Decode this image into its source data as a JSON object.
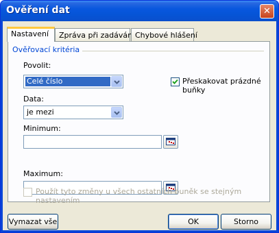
{
  "window": {
    "title": "Ověření dat"
  },
  "tabs": [
    {
      "label": "Nastavení"
    },
    {
      "label": "Zpráva při zadávání"
    },
    {
      "label": "Chybové hlášení"
    }
  ],
  "criteria": {
    "group_label": "Ověřovací kritéria",
    "allow_label": "Povolit:",
    "allow_value": "Celé číslo",
    "ignore_blank_label": "Přeskakovat prázdné buňky",
    "ignore_blank_checked": true,
    "data_label": "Data:",
    "data_value": "je mezi",
    "minimum_label": "Minimum:",
    "minimum_value": "",
    "maximum_label": "Maximum:",
    "maximum_value": ""
  },
  "apply_all": {
    "label": "Použít tyto změny u všech ostatních buněk se stejným nastavením",
    "checked": false,
    "enabled": false
  },
  "buttons": {
    "clear_all": "Vymazat vše",
    "ok": "OK",
    "cancel": "Storno"
  },
  "icons": {
    "close": "close-icon",
    "dropdown": "chevron-down-icon",
    "range_select": "range-select-icon",
    "check": "checkmark-icon"
  }
}
